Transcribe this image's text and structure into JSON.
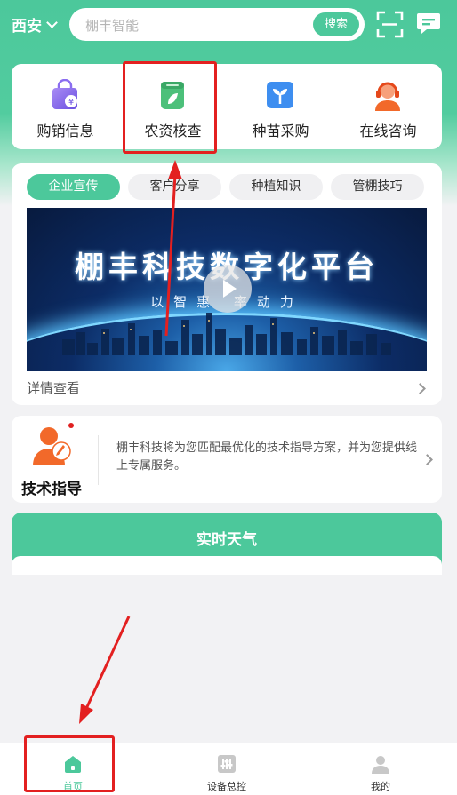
{
  "header": {
    "city": "西安",
    "search_placeholder": "棚丰智能",
    "search_button": "搜索",
    "icons": [
      "chevron-down-icon",
      "scan-icon",
      "message-icon"
    ]
  },
  "quick_menu": [
    {
      "label": "购销信息",
      "icon": "shopping-bag-icon"
    },
    {
      "label": "农资核查",
      "icon": "leaf-box-icon"
    },
    {
      "label": "种苗采购",
      "icon": "seedling-icon"
    },
    {
      "label": "在线咨询",
      "icon": "headset-agent-icon"
    }
  ],
  "content": {
    "tabs": [
      "企业宣传",
      "客户分享",
      "种植知识",
      "管棚技巧"
    ],
    "active_tab": "企业宣传",
    "video_title": "棚丰科技数字化平台",
    "video_subtitle": "以智惠  率动力",
    "detail_link": "详情查看"
  },
  "tech_guide": {
    "label": "技术指导",
    "description": "棚丰科技将为您匹配最优化的技术指导方案，并为您提供线上专属服务。"
  },
  "weather": {
    "title": "实时天气"
  },
  "bottom_nav": [
    {
      "label": "首页",
      "icon": "home-icon",
      "active": true
    },
    {
      "label": "设备总控",
      "icon": "equalizer-icon",
      "active": false
    },
    {
      "label": "我的",
      "icon": "user-icon",
      "active": false
    }
  ],
  "colors": {
    "brand": "#4cc89b",
    "annotation_red": "#e32020"
  }
}
